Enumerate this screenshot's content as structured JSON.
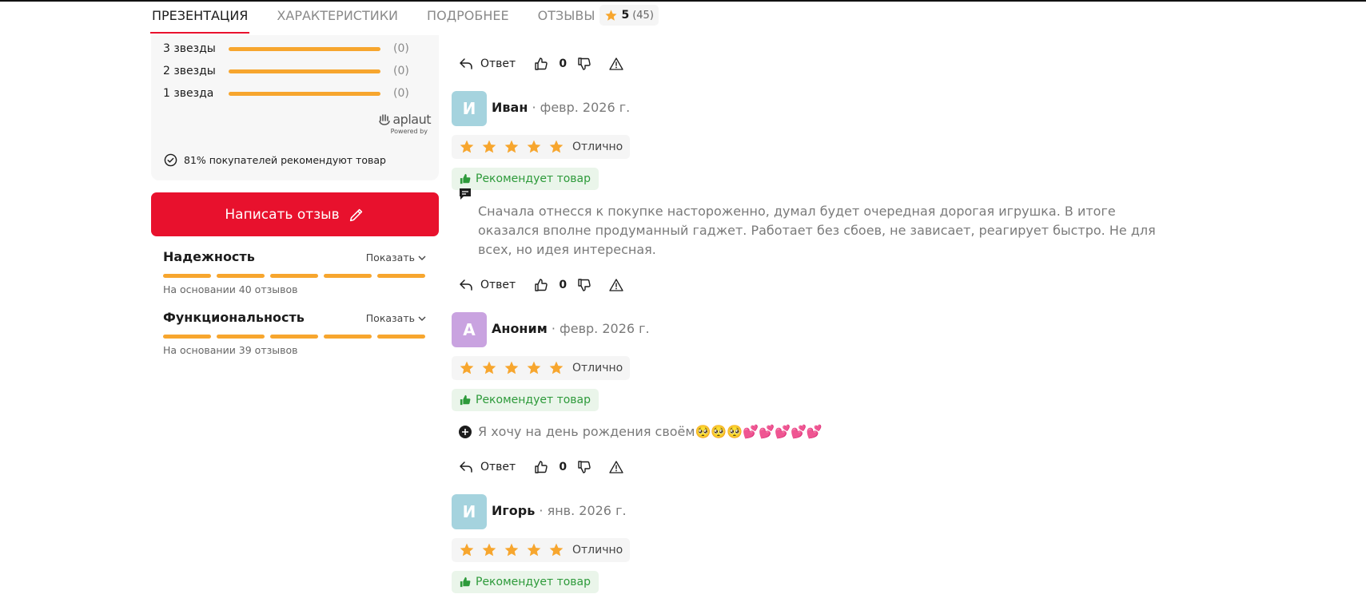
{
  "nav": {
    "tabs": [
      {
        "label": "ПРЕЗЕНТАЦИЯ",
        "active": true
      },
      {
        "label": "ХАРАКТЕРИСТИКИ",
        "active": false
      },
      {
        "label": "ПОДРОБНЕЕ",
        "active": false
      },
      {
        "label": "ОТЗЫВЫ",
        "active": false
      }
    ],
    "rating_value": "5",
    "rating_count": "(45)"
  },
  "distribution": [
    {
      "label": "3 звезды",
      "count": "(0)",
      "fraction": 1.0
    },
    {
      "label": "2 звезды",
      "count": "(0)",
      "fraction": 1.0
    },
    {
      "label": "1 звезда",
      "count": "(0)",
      "fraction": 1.0
    }
  ],
  "aplaut": {
    "logo": "aplaut",
    "powered": "Powered by"
  },
  "recommend_summary": "81% покупателей рекомендуют товар",
  "write_review_label": "Написать отзыв",
  "attributes": [
    {
      "title": "Надежность",
      "show_label": "Показать",
      "note": "На основании 40 отзывов",
      "segments_filled": 5
    },
    {
      "title": "Функциональность",
      "show_label": "Показать",
      "note": "На основании 39 отзывов",
      "segments_filled": 5
    }
  ],
  "actions_labels": {
    "reply": "Ответ"
  },
  "first_actions": {
    "likes": "0"
  },
  "reviews": [
    {
      "initial": "И",
      "avatar_color": "#a5d3de",
      "author": "Иван",
      "date": "· февр. 2026 г.",
      "stars": 5,
      "rating_text": "Отлично",
      "recommend": "Рекомендует товар",
      "comment_icon": "speech-bubble-icon",
      "comment": "Сначала отнесся к покупке настороженно, думал будет очередная дорогая игрушка. В итоге оказался вполне продуманный гаджет. Работает без сбоев, не зависает, реагирует быстро. Не для всех, но идея интересная.",
      "likes": "0"
    },
    {
      "initial": "А",
      "avatar_color": "#c9a3e0",
      "author": "Аноним",
      "date": "· февр. 2026 г.",
      "stars": 5,
      "rating_text": "Отлично",
      "recommend": "Рекомендует товар",
      "comment_icon": "plus-circle-icon",
      "comment": "Я хочу на день рождения своём🥺🥺🥺💕💕💕💕💕",
      "likes": "0"
    },
    {
      "initial": "И",
      "avatar_color": "#a5d3de",
      "author": "Игорь",
      "date": "· янв. 2026 г.",
      "stars": 5,
      "rating_text": "Отлично",
      "recommend": "Рекомендует товар"
    }
  ],
  "colors": {
    "accent_red": "#e8112d",
    "star_orange": "#f7a62e",
    "recommend_green": "#2d9a3a"
  }
}
